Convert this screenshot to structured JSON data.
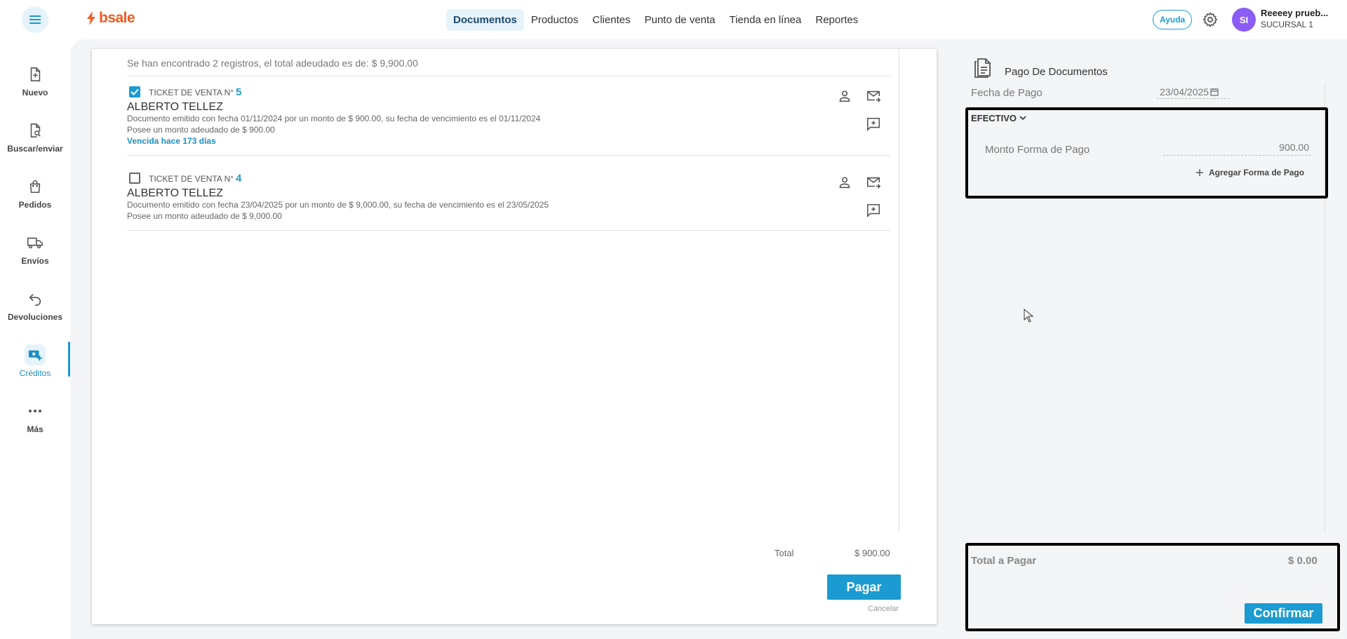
{
  "header": {
    "logo_text": "bsale",
    "nav": [
      {
        "label": "Documentos",
        "active": true
      },
      {
        "label": "Productos"
      },
      {
        "label": "Clientes"
      },
      {
        "label": "Punto de venta"
      },
      {
        "label": "Tienda en línea"
      },
      {
        "label": "Reportes"
      }
    ],
    "help_label": "Ayuda",
    "avatar_initials": "SI",
    "user_name": "Reeeey prueb...",
    "user_branch": "SUCURSAL 1"
  },
  "sidebar": {
    "items": [
      {
        "label": "Nuevo",
        "icon": "file-plus-icon"
      },
      {
        "label": "Buscar/enviar",
        "icon": "file-search-icon"
      },
      {
        "label": "Pedidos",
        "icon": "shopping-bag-icon"
      },
      {
        "label": "Envíos",
        "icon": "truck-icon"
      },
      {
        "label": "Devoluciones",
        "icon": "return-icon"
      },
      {
        "label": "Créditos",
        "icon": "credit-icon",
        "active": true
      },
      {
        "label": "Más",
        "icon": "more-dots-icon"
      }
    ]
  },
  "documents": {
    "summary": "Se han encontrado 2 registros, el total adeudado es de: $ 9,900.00",
    "items": [
      {
        "checked": true,
        "type": "TICKET DE VENTA N°",
        "number": "5",
        "client": "ALBERTO TELLEZ",
        "description": "Documento emitido con fecha 01/11/2024 por un monto de $ 900.00, su fecha de vencimiento es el 01/11/2024",
        "owed": "Posee un monto adeudado de $ 900.00",
        "overdue": "Vencida hace 173 días"
      },
      {
        "checked": false,
        "type": "TICKET DE VENTA N°",
        "number": "4",
        "client": "ALBERTO TELLEZ",
        "description": "Documento emitido con fecha 23/04/2025 por un monto de $ 9,000.00, su fecha de vencimiento es el 23/05/2025",
        "owed": "Posee un monto adeudado de $ 9,000.00"
      }
    ],
    "total_label": "Total",
    "total_value": "$ 900.00",
    "pay_label": "Pagar",
    "cancel_label": "Cancelar"
  },
  "payment": {
    "title": "Pago De Documentos",
    "fecha_label": "Fecha de Pago",
    "fecha_value": "23/04/2025",
    "method": "EFECTIVO",
    "monto_label": "Monto Forma de Pago",
    "monto_value": "900.00",
    "add_label": "Agregar Forma de Pago",
    "total_label": "Total a Pagar",
    "total_value": "$ 0.00",
    "confirm_label": "Confirmar"
  },
  "colors": {
    "accent": "#1b9bd1",
    "brand": "#f15a22",
    "avatar": "#8b5cf6"
  }
}
